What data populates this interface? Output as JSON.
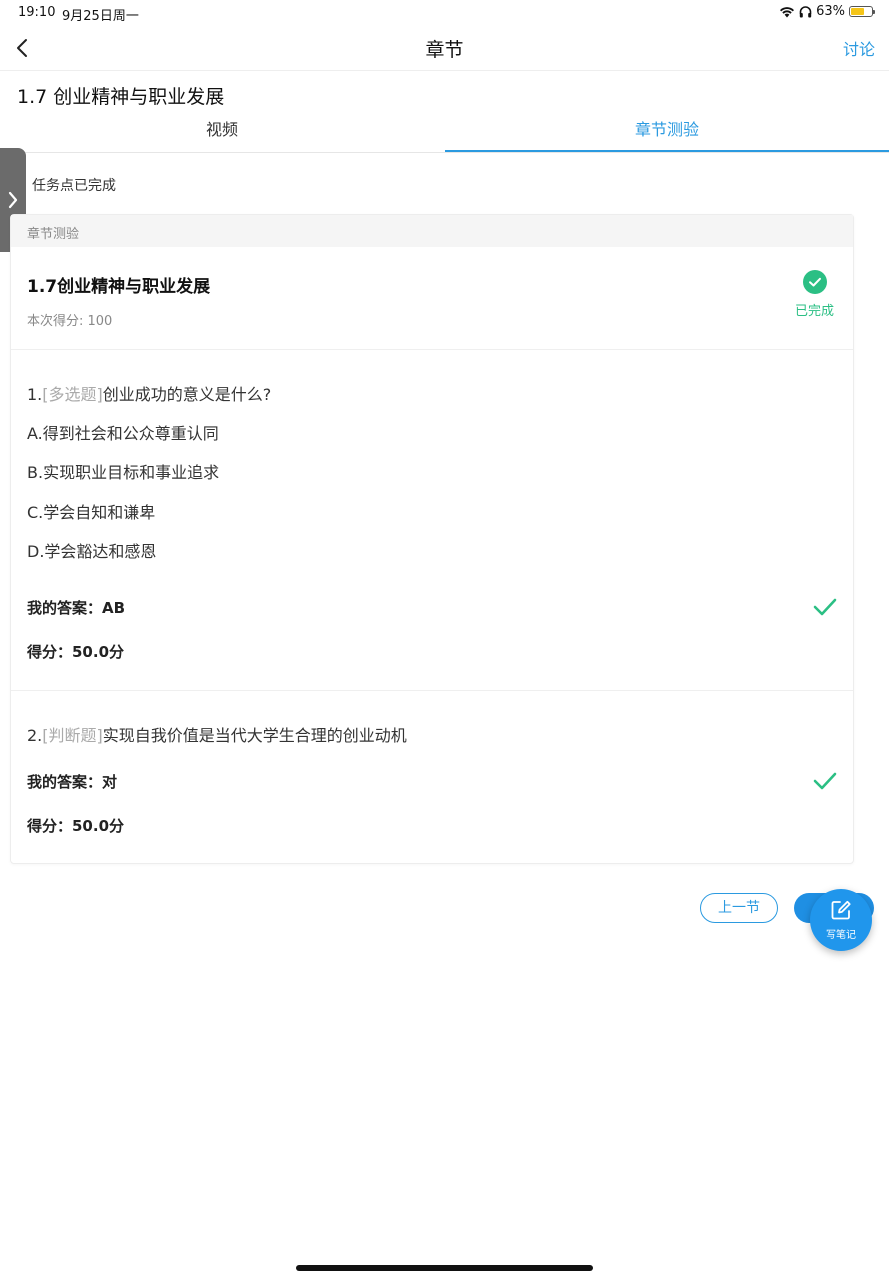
{
  "status_bar": {
    "time": "19:10",
    "date": "9月25日周一",
    "battery_percent": "63%",
    "battery_level": 0.63
  },
  "nav": {
    "title": "章节",
    "discuss_label": "讨论"
  },
  "chapter_title": "1.7 创业精神与职业发展",
  "tabs": [
    {
      "label": "视频",
      "active": false
    },
    {
      "label": "章节测验",
      "active": true
    }
  ],
  "task_status": "任务点已完成",
  "quiz": {
    "section_label": "章节测验",
    "title": "1.7创业精神与职业发展",
    "score_text": "本次得分: 100",
    "status": "已完成",
    "questions": [
      {
        "number": "1.",
        "type": "[多选题]",
        "text": "创业成功的意义是什么?",
        "options": [
          "A.得到社会和公众尊重认同",
          "B.实现职业目标和事业追求",
          "C.学会自知和谦卑",
          "D.学会豁达和感恩"
        ],
        "my_answer": "我的答案：AB",
        "score": "得分：50.0分"
      },
      {
        "number": "2.",
        "type": "[判断题]",
        "text": "实现自我价值是当代大学生合理的创业动机",
        "my_answer": "我的答案：对",
        "score": "得分：50.0分"
      }
    ]
  },
  "buttons": {
    "prev": "上一节",
    "note": "写笔记"
  },
  "colors": {
    "accent": "#2b9ae0",
    "success": "#2bbf84"
  },
  "icons": {
    "back": "chevron-left-icon",
    "side": "chevron-right-icon",
    "status": "check-circle-icon",
    "correct": "check-icon",
    "note": "edit-note-icon"
  }
}
